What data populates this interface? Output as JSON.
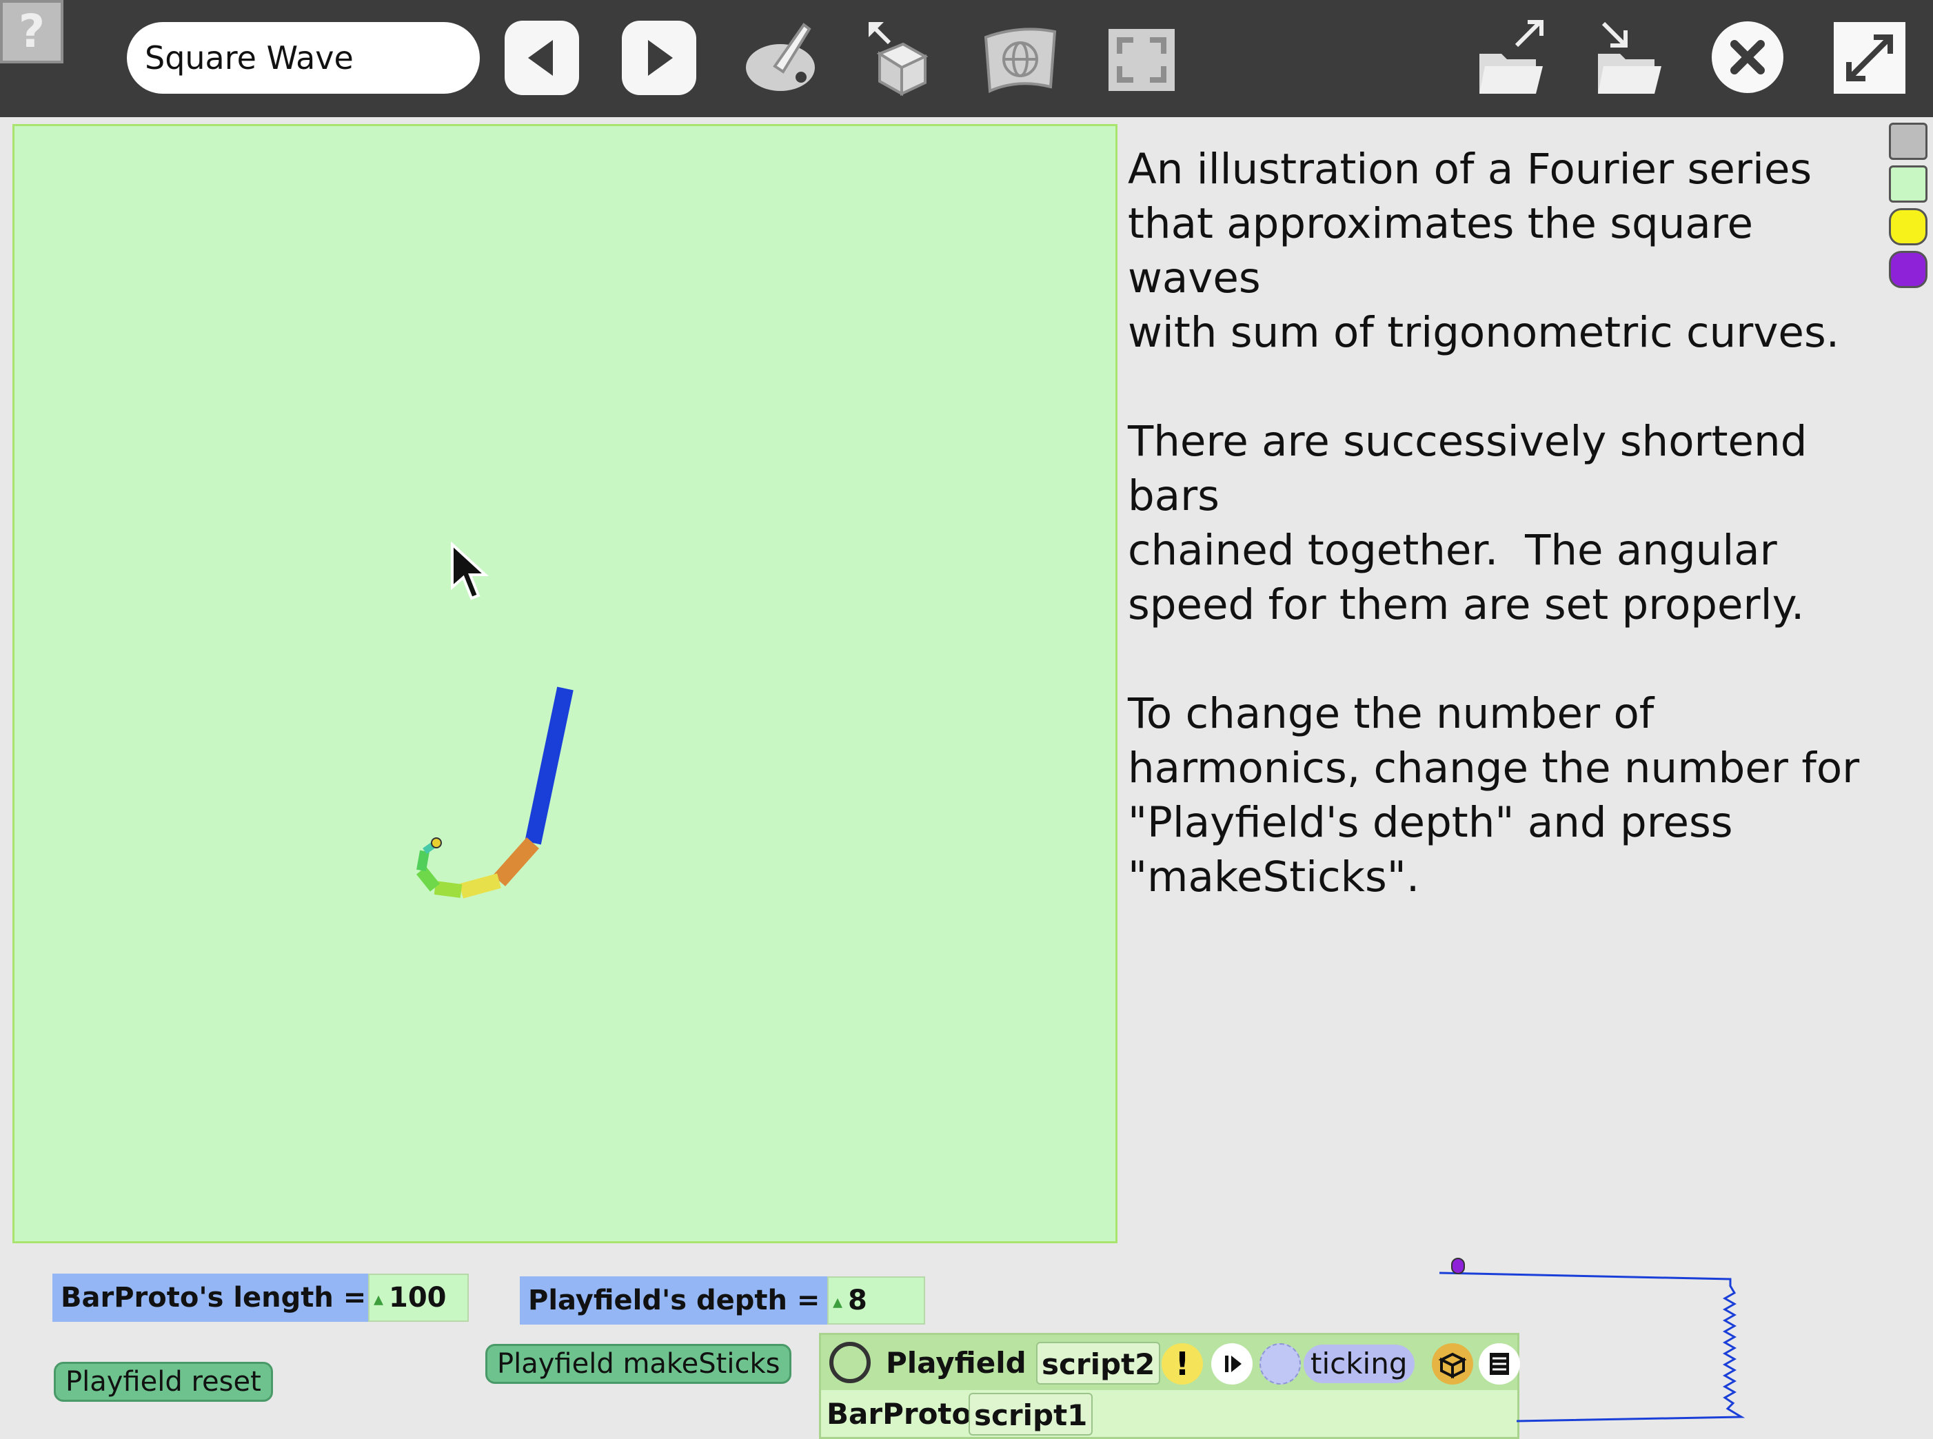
{
  "toolbar": {
    "help_label": "?",
    "project_name": "Square Wave",
    "icons": [
      "previous-page-icon",
      "next-page-icon",
      "paint-icon",
      "supplies-icon",
      "world-icon",
      "fullscreen-frame-icon",
      "publish-icon",
      "load-project-icon",
      "close-icon",
      "expand-icon"
    ]
  },
  "description": "An illustration of a Fourier series\nthat approximates the square\nwaves\nwith sum of trigonometric curves.\n\nThere are successively shortend\nbars\nchained together.  The angular\nspeed for them are set properly.\n\nTo change the number of\nharmonics, change the number for\n\"Playfield's depth\" and press\n\"makeSticks\".",
  "flaps": {
    "colors": [
      "#bcbcbc",
      "#c9f7c4",
      "#f7f21a",
      "#8e22d8"
    ]
  },
  "watchers": {
    "bar_length": {
      "label": "BarProto's length  =",
      "value": "100"
    },
    "depth": {
      "label": "Playfield's depth  =",
      "value": "8"
    }
  },
  "buttons": {
    "reset": "Playfield reset",
    "make_sticks": "Playfield makeSticks"
  },
  "script_panel": {
    "object": "Playfield",
    "script": "script2",
    "status": "ticking",
    "row2_object": "BarProto",
    "row2_script": "script1"
  },
  "colors": {
    "playfield_bg": "#c9f7c4",
    "long_bar": "#1a3fd8",
    "watcher_label_bg": "#94b6f4",
    "button_bg": "#6dc28d"
  }
}
